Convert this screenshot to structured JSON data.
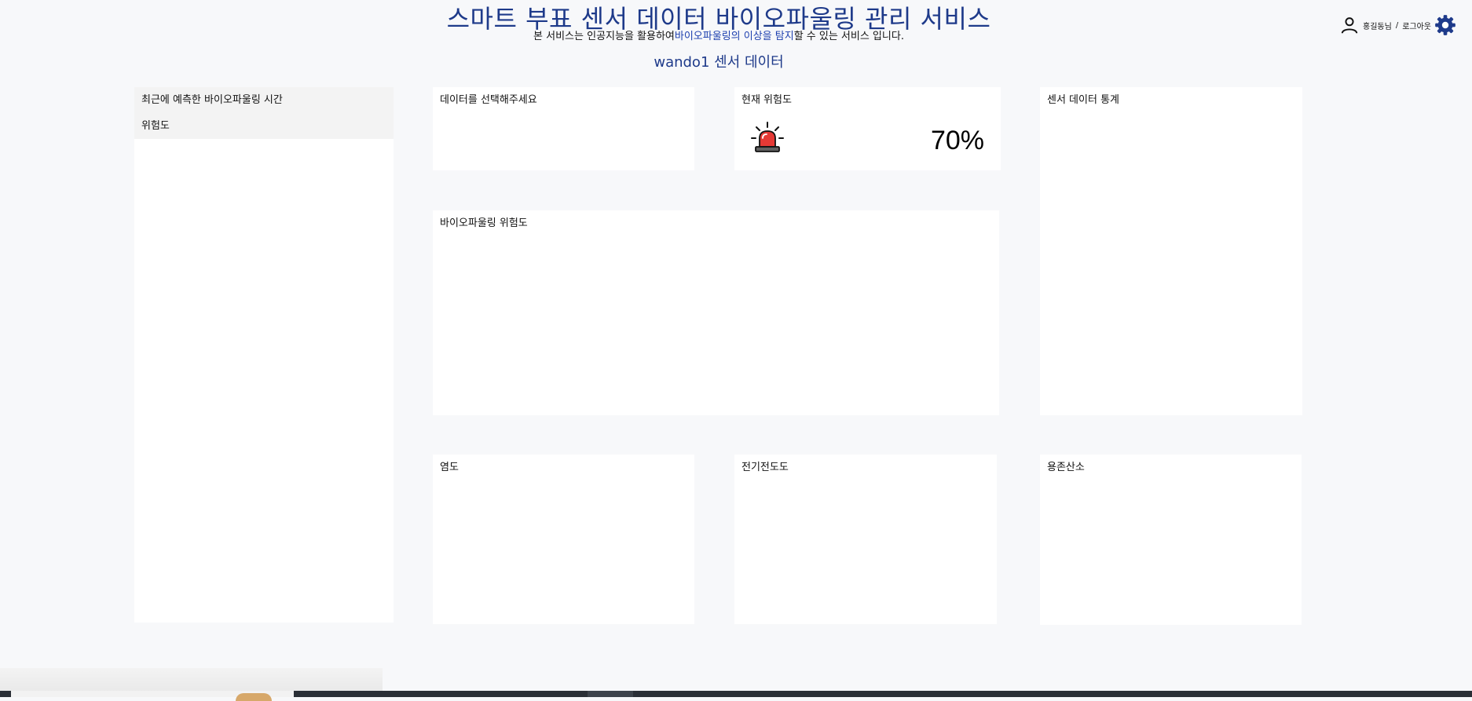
{
  "header": {
    "title": "스마트 부표 센서 데이터 바이오파울링 관리 서비스",
    "subtitle_pre": "본 서비스는 인공지능을 활용하여",
    "subtitle_highlight": "바이오파울링의 이상을 탐지",
    "subtitle_post": "할 수 있는 서비스 입니다.",
    "sensor_heading": "wando1 센서 데이터"
  },
  "user": {
    "name": "홍길동님",
    "separator": "/",
    "logout_label": "로그아웃",
    "user_icon": "user-icon",
    "settings_icon": "gear-icon"
  },
  "panels": {
    "left": {
      "recent_title": "최근에 예측한 바이오파울링 시간",
      "risk_label": "위험도"
    },
    "select_data": {
      "title": "데이터를 선택해주세요"
    },
    "current_risk": {
      "title": "현재 위험도",
      "value": "70%",
      "icon": "siren-icon"
    },
    "sensor_stats": {
      "title": "센서 데이터 통계"
    },
    "fouling_risk": {
      "title": "바이오파울링 위험도"
    },
    "salinity": {
      "title": "염도"
    },
    "conductivity": {
      "title": "전기전도도"
    },
    "dissolved_oxygen": {
      "title": "용존산소"
    }
  },
  "colors": {
    "title": "#1e3a8a",
    "background": "#f7f8fa",
    "panel": "#ffffff",
    "siren_red": "#e53935"
  }
}
